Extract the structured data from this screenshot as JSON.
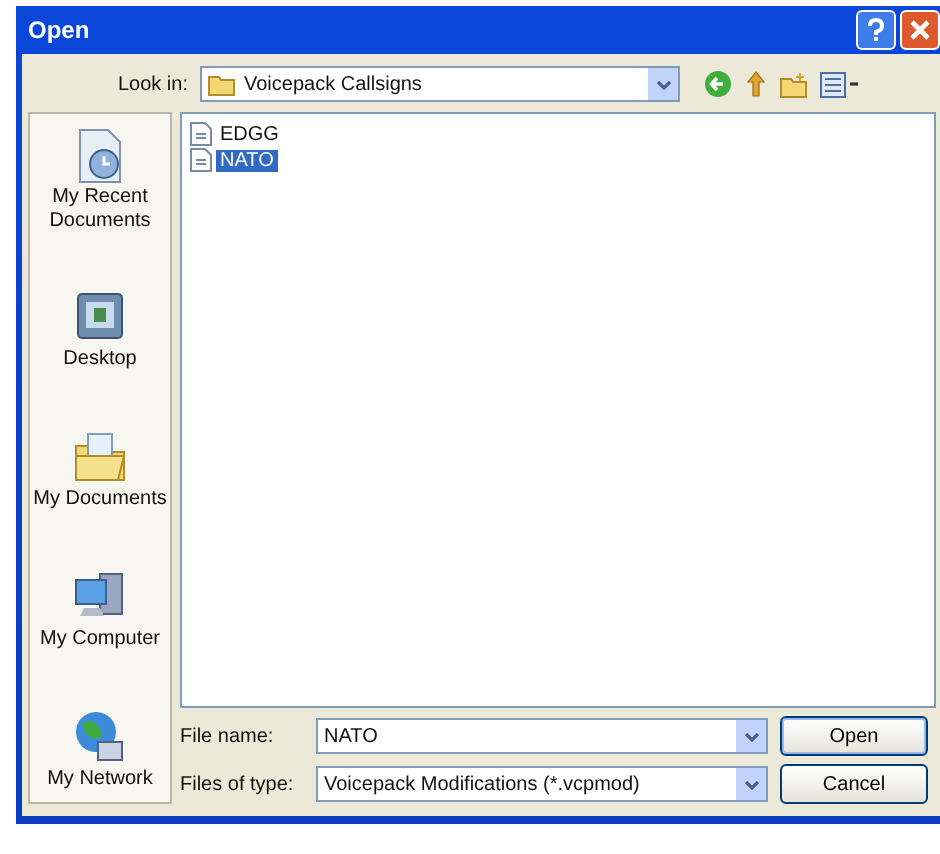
{
  "window": {
    "title": "Open"
  },
  "look_in": {
    "label": "Look in:",
    "value": "Voicepack Callsigns"
  },
  "places": [
    {
      "label": "My Recent Documents",
      "kind": "recent"
    },
    {
      "label": "Desktop",
      "kind": "desktop"
    },
    {
      "label": "My Documents",
      "kind": "documents"
    },
    {
      "label": "My Computer",
      "kind": "computer"
    },
    {
      "label": "My Network",
      "kind": "network"
    }
  ],
  "files": [
    {
      "name": "EDGG",
      "selected": false
    },
    {
      "name": "NATO",
      "selected": true
    }
  ],
  "file_name": {
    "label": "File name:",
    "value": "NATO"
  },
  "file_type": {
    "label": "Files of type:",
    "value": "Voicepack Modifications (*.vcpmod)"
  },
  "buttons": [
    {
      "label": "Open",
      "kind": "default"
    },
    {
      "label": "Cancel",
      "kind": "normal"
    }
  ]
}
